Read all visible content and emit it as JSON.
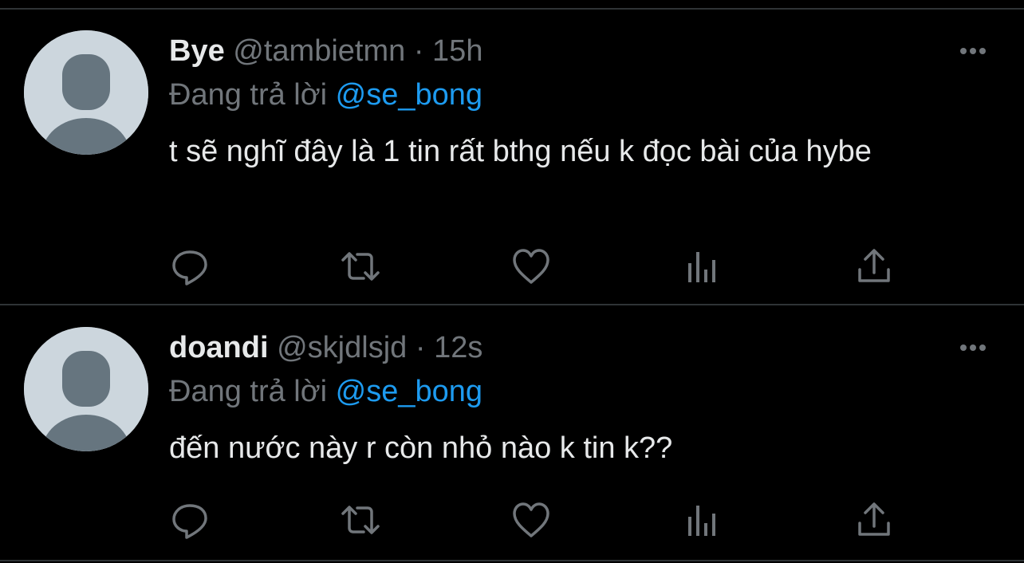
{
  "colors": {
    "background": "#000000",
    "divider": "#2f3336",
    "primary_text": "#e7e9ea",
    "secondary_text": "#71767b",
    "mention": "#1d9bf0",
    "avatar_bg": "#ccd6dd",
    "avatar_fg": "#66757f"
  },
  "tweets": [
    {
      "display_name": "Bye",
      "handle": "@tambietmn",
      "separator": "·",
      "time": "15h",
      "reply_prefix": "Đang trả lời",
      "reply_to": "@se_bong",
      "text": "t sẽ nghĩ đây là 1 tin rất bthg nếu k đọc bài của hybe",
      "actions": [
        "reply-icon",
        "retweet-icon",
        "like-icon",
        "analytics-icon",
        "share-icon"
      ],
      "more_icon": "more-icon"
    },
    {
      "display_name": "doandi",
      "handle": "@skjdlsjd",
      "separator": "·",
      "time": "12s",
      "reply_prefix": "Đang trả lời",
      "reply_to": "@se_bong",
      "text": "đến nước này r còn nhỏ nào k tin k??",
      "actions": [
        "reply-icon",
        "retweet-icon",
        "like-icon",
        "analytics-icon",
        "share-icon"
      ],
      "more_icon": "more-icon"
    }
  ]
}
